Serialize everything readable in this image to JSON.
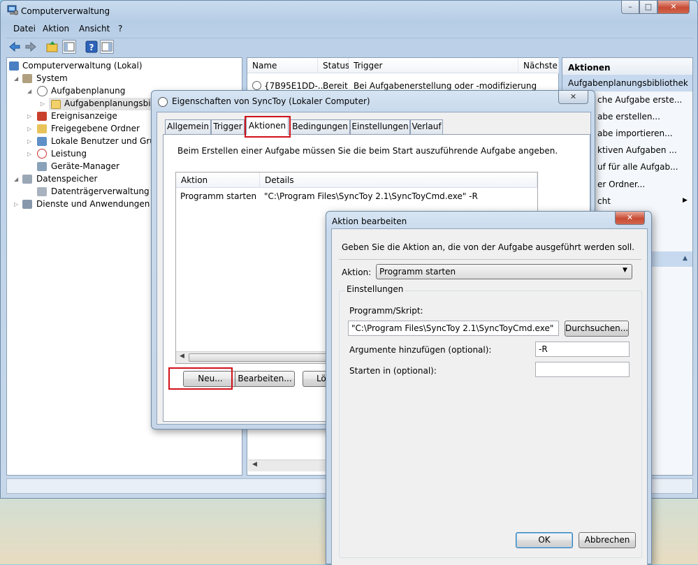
{
  "main_window": {
    "title": "Computerverwaltung",
    "caption_buttons": {
      "minimize": "–",
      "maximize": "□",
      "close": "✕"
    },
    "menu": [
      "Datei",
      "Aktion",
      "Ansicht",
      "?"
    ],
    "tree": {
      "root": "Computerverwaltung (Lokal)",
      "system": "System",
      "aufgabenplanung": "Aufgabenplanung",
      "bibliothek": "Aufgabenplanungsbibliothek",
      "ereignisanzeige": "Ereignisanzeige",
      "freigegebene_ordner": "Freigegebene Ordner",
      "lokale_benutzer": "Lokale Benutzer und Gruppen",
      "leistung": "Leistung",
      "geraete_manager": "Geräte-Manager",
      "datenspeicher": "Datenspeicher",
      "datentraegerverwaltung": "Datenträgerverwaltung",
      "dienste": "Dienste und Anwendungen"
    },
    "task_list": {
      "columns": [
        "Name",
        "Status",
        "Trigger",
        "Nächste"
      ],
      "rows": [
        {
          "name": "{7B95E1DD-...",
          "status": "Bereit",
          "trigger": "Bei Aufgabenerstellung oder -modifizierung"
        }
      ]
    },
    "actions_pane": {
      "header": "Aktionen",
      "section": "Aufgabenplanungsbibliothek",
      "items": [
        "che Aufgabe erste...",
        "abe erstellen...",
        "abe importieren...",
        "ktiven Aufgaben ...",
        "uf für alle Aufgab...",
        "er Ordner...",
        "cht"
      ]
    }
  },
  "props_dialog": {
    "title": "Eigenschaften von SyncToy (Lokaler Computer)",
    "close": "✕",
    "tabs": [
      "Allgemein",
      "Trigger",
      "Aktionen",
      "Bedingungen",
      "Einstellungen",
      "Verlauf"
    ],
    "active_tab": "Aktionen",
    "description": "Beim Erstellen einer Aufgabe müssen Sie die beim Start auszuführende Aufgabe angeben.",
    "columns": [
      "Aktion",
      "Details"
    ],
    "rows": [
      {
        "aktion": "Programm starten",
        "details": "\"C:\\Program Files\\SyncToy 2.1\\SyncToyCmd.exe\" -R"
      }
    ],
    "buttons": {
      "new": "Neu...",
      "edit": "Bearbeiten...",
      "delete": "Lös"
    }
  },
  "edit_dialog": {
    "title": "Aktion bearbeiten",
    "close": "✕",
    "instruction": "Geben Sie die Aktion an, die von der Aufgabe ausgeführt werden soll.",
    "action_label": "Aktion:",
    "action_value": "Programm starten",
    "group_label": "Einstellungen",
    "program_label": "Programm/Skript:",
    "program_value": "\"C:\\Program Files\\SyncToy 2.1\\SyncToyCmd.exe\"",
    "browse_button": "Durchsuchen...",
    "args_label": "Argumente hinzufügen (optional):",
    "args_value": "-R",
    "start_in_label": "Starten in (optional):",
    "start_in_value": "",
    "ok": "OK",
    "cancel": "Abbrechen"
  }
}
